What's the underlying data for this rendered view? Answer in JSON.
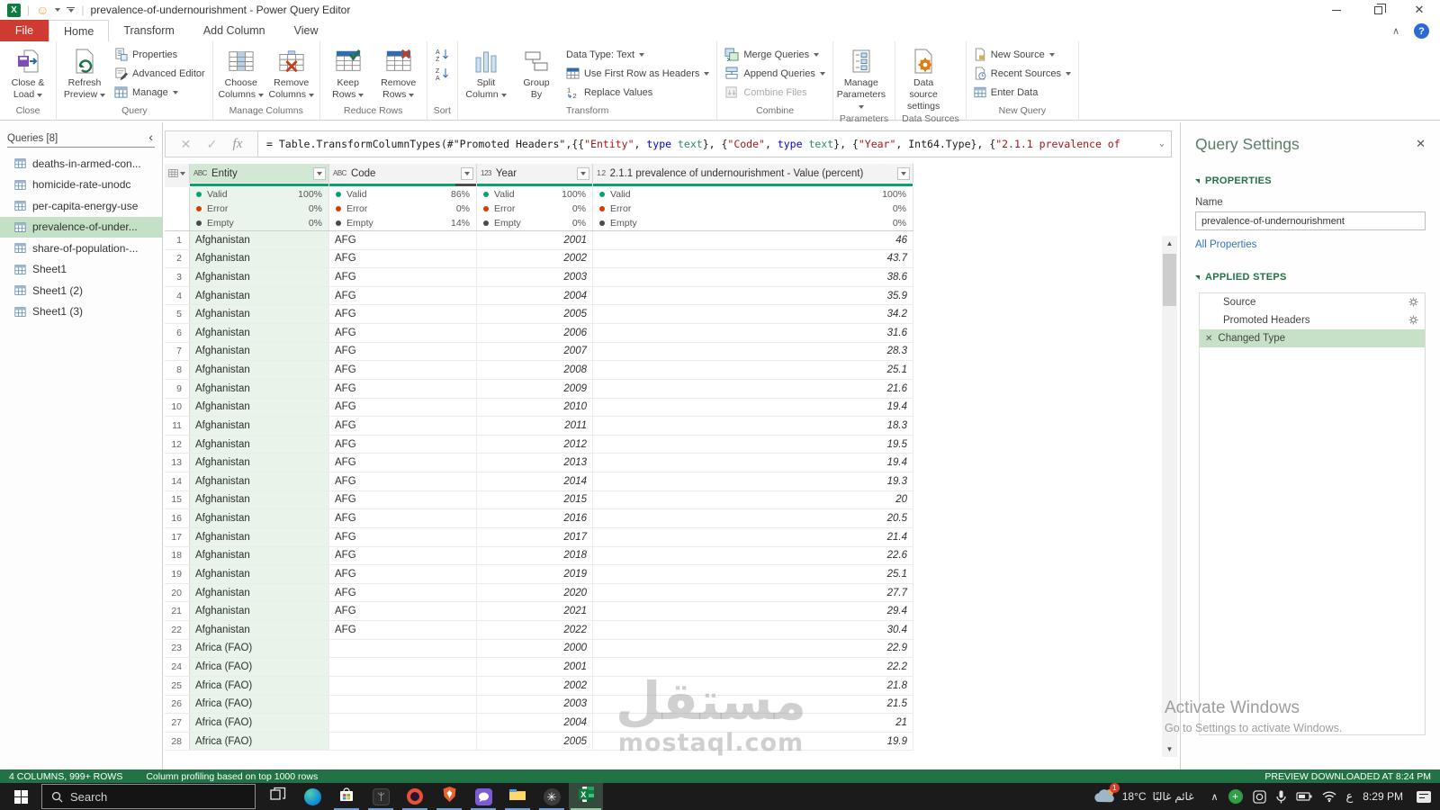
{
  "window": {
    "title": "prevalence-of-undernourishment - Power Query Editor"
  },
  "tabs": [
    {
      "label": "File",
      "file": true
    },
    {
      "label": "Home",
      "active": true
    },
    {
      "label": "Transform"
    },
    {
      "label": "Add Column"
    },
    {
      "label": "View"
    }
  ],
  "ribbon": {
    "close_group": {
      "label": "Close",
      "close_load_1": "Close &",
      "close_load_2": "Load"
    },
    "query_group": {
      "label": "Query",
      "refresh_1": "Refresh",
      "refresh_2": "Preview",
      "properties": "Properties",
      "advanced_editor": "Advanced Editor",
      "manage": "Manage"
    },
    "manage_columns_group": {
      "label": "Manage Columns",
      "choose_1": "Choose",
      "choose_2": "Columns",
      "remove_1": "Remove",
      "remove_2": "Columns"
    },
    "reduce_rows_group": {
      "label": "Reduce Rows",
      "keep_1": "Keep",
      "keep_2": "Rows",
      "remove_1": "Remove",
      "remove_2": "Rows"
    },
    "sort_group": {
      "label": "Sort"
    },
    "transform_group": {
      "label": "Transform",
      "split_1": "Split",
      "split_2": "Column",
      "group_1": "Group",
      "group_2": "By",
      "data_type": "Data Type: Text",
      "first_row": "Use First Row as Headers",
      "replace": "Replace Values"
    },
    "combine_group": {
      "label": "Combine",
      "merge": "Merge Queries",
      "append": "Append Queries",
      "combine_files": "Combine Files"
    },
    "parameters_group": {
      "label": "Parameters",
      "manage_1": "Manage",
      "manage_2": "Parameters"
    },
    "data_sources_group": {
      "label": "Data Sources",
      "settings_1": "Data source",
      "settings_2": "settings"
    },
    "new_query_group": {
      "label": "New Query",
      "new_source": "New Source",
      "recent_sources": "Recent Sources",
      "enter_data": "Enter Data"
    }
  },
  "formula": {
    "segments": [
      {
        "cls": "plain",
        "text": "= Table.TransformColumnTypes(#\"Promoted Headers\",{{"
      },
      {
        "cls": "str",
        "text": "\"Entity\""
      },
      {
        "cls": "plain",
        "text": ", "
      },
      {
        "cls": "kw",
        "text": "type"
      },
      {
        "cls": "plain",
        "text": " "
      },
      {
        "cls": "type",
        "text": "text"
      },
      {
        "cls": "plain",
        "text": "}, {"
      },
      {
        "cls": "str",
        "text": "\"Code\""
      },
      {
        "cls": "plain",
        "text": ", "
      },
      {
        "cls": "kw",
        "text": "type"
      },
      {
        "cls": "plain",
        "text": " "
      },
      {
        "cls": "type",
        "text": "text"
      },
      {
        "cls": "plain",
        "text": "}, {"
      },
      {
        "cls": "str",
        "text": "\"Year\""
      },
      {
        "cls": "plain",
        "text": ", Int64.Type}, {"
      },
      {
        "cls": "str",
        "text": "\"2.1.1 prevalence of"
      }
    ]
  },
  "queries_pane": {
    "header": "Queries [8]",
    "items": [
      {
        "label": "deaths-in-armed-con...",
        "selected": false
      },
      {
        "label": "homicide-rate-unodc",
        "selected": false
      },
      {
        "label": "per-capita-energy-use",
        "selected": false
      },
      {
        "label": "prevalence-of-under...",
        "selected": true
      },
      {
        "label": "share-of-population-...",
        "selected": false
      },
      {
        "label": "Sheet1",
        "selected": false
      },
      {
        "label": "Sheet1 (2)",
        "selected": false
      },
      {
        "label": "Sheet1 (3)",
        "selected": false
      }
    ]
  },
  "table": {
    "stat_labels": {
      "valid": "Valid",
      "error": "Error",
      "empty": "Empty"
    },
    "columns": [
      {
        "type_label": "ABC",
        "name": "Entity",
        "selected": true,
        "valid": "100%",
        "error": "0%",
        "empty": "0%",
        "bar_valid": 100
      },
      {
        "type_label": "ABC",
        "name": "Code",
        "selected": false,
        "valid": "86%",
        "error": "0%",
        "empty": "14%",
        "bar_valid": 86
      },
      {
        "type_label": "123",
        "name": "Year",
        "selected": false,
        "valid": "100%",
        "error": "0%",
        "empty": "0%",
        "bar_valid": 100
      },
      {
        "type_label": "1.2",
        "name": "2.1.1 prevalence of undernourishment - Value (percent)",
        "selected": false,
        "valid": "100%",
        "error": "0%",
        "empty": "0%",
        "bar_valid": 100
      }
    ],
    "rows": [
      [
        "1",
        "Afghanistan",
        "AFG",
        "2001",
        "46"
      ],
      [
        "2",
        "Afghanistan",
        "AFG",
        "2002",
        "43.7"
      ],
      [
        "3",
        "Afghanistan",
        "AFG",
        "2003",
        "38.6"
      ],
      [
        "4",
        "Afghanistan",
        "AFG",
        "2004",
        "35.9"
      ],
      [
        "5",
        "Afghanistan",
        "AFG",
        "2005",
        "34.2"
      ],
      [
        "6",
        "Afghanistan",
        "AFG",
        "2006",
        "31.6"
      ],
      [
        "7",
        "Afghanistan",
        "AFG",
        "2007",
        "28.3"
      ],
      [
        "8",
        "Afghanistan",
        "AFG",
        "2008",
        "25.1"
      ],
      [
        "9",
        "Afghanistan",
        "AFG",
        "2009",
        "21.6"
      ],
      [
        "10",
        "Afghanistan",
        "AFG",
        "2010",
        "19.4"
      ],
      [
        "11",
        "Afghanistan",
        "AFG",
        "2011",
        "18.3"
      ],
      [
        "12",
        "Afghanistan",
        "AFG",
        "2012",
        "19.5"
      ],
      [
        "13",
        "Afghanistan",
        "AFG",
        "2013",
        "19.4"
      ],
      [
        "14",
        "Afghanistan",
        "AFG",
        "2014",
        "19.3"
      ],
      [
        "15",
        "Afghanistan",
        "AFG",
        "2015",
        "20"
      ],
      [
        "16",
        "Afghanistan",
        "AFG",
        "2016",
        "20.5"
      ],
      [
        "17",
        "Afghanistan",
        "AFG",
        "2017",
        "21.4"
      ],
      [
        "18",
        "Afghanistan",
        "AFG",
        "2018",
        "22.6"
      ],
      [
        "19",
        "Afghanistan",
        "AFG",
        "2019",
        "25.1"
      ],
      [
        "20",
        "Afghanistan",
        "AFG",
        "2020",
        "27.7"
      ],
      [
        "21",
        "Afghanistan",
        "AFG",
        "2021",
        "29.4"
      ],
      [
        "22",
        "Afghanistan",
        "AFG",
        "2022",
        "30.4"
      ],
      [
        "23",
        "Africa (FAO)",
        "",
        "2000",
        "22.9"
      ],
      [
        "24",
        "Africa (FAO)",
        "",
        "2001",
        "22.2"
      ],
      [
        "25",
        "Africa (FAO)",
        "",
        "2002",
        "21.8"
      ],
      [
        "26",
        "Africa (FAO)",
        "",
        "2003",
        "21.5"
      ],
      [
        "27",
        "Africa (FAO)",
        "",
        "2004",
        "21"
      ],
      [
        "28",
        "Africa (FAO)",
        "",
        "2005",
        "19.9"
      ]
    ]
  },
  "query_settings": {
    "title": "Query Settings",
    "properties_header": "PROPERTIES",
    "name_label": "Name",
    "name_value": "prevalence-of-undernourishment",
    "all_properties": "All Properties",
    "steps_header": "APPLIED STEPS",
    "steps": [
      {
        "label": "Source",
        "gear": true,
        "selected": false
      },
      {
        "label": "Promoted Headers",
        "gear": true,
        "selected": false
      },
      {
        "label": "Changed Type",
        "gear": false,
        "selected": true
      }
    ]
  },
  "status_bar": {
    "columns_info": "4 COLUMNS, 999+ ROWS",
    "profiling_info": "Column profiling based on top 1000 rows",
    "preview_info": "PREVIEW DOWNLOADED AT 8:24 PM"
  },
  "watermark": {
    "line1": "مستقل",
    "line2": "mostaql.com"
  },
  "activate": {
    "line1": "Activate Windows",
    "line2": "Go to Settings to activate Windows."
  },
  "taskbar": {
    "search_placeholder": "Search",
    "apps": [
      {
        "name": "task-view",
        "underline": false,
        "active": false
      },
      {
        "name": "edge",
        "underline": false,
        "active": false
      },
      {
        "name": "store",
        "underline": true,
        "active": false
      },
      {
        "name": "dark-app",
        "underline": true,
        "active": false
      },
      {
        "name": "opera",
        "underline": true,
        "active": false
      },
      {
        "name": "brave",
        "underline": true,
        "active": false
      },
      {
        "name": "chat-app",
        "underline": true,
        "active": false
      },
      {
        "name": "explorer",
        "underline": true,
        "active": false
      },
      {
        "name": "chatgpt",
        "underline": true,
        "active": false
      },
      {
        "name": "excel",
        "underline": true,
        "active": true
      }
    ],
    "weather": {
      "badge": "1",
      "temp": "18°C",
      "desc": "غائم غالبًا"
    },
    "lang": "ع",
    "time": "8:29 PM"
  },
  "colors": {
    "excel_green": "#217346",
    "valid_teal": "#07a36b",
    "error_orange": "#d83b01",
    "empty_dark": "#4a4a4a",
    "selection_green": "#c4e0c6",
    "file_tab_red": "#cf3b30"
  }
}
